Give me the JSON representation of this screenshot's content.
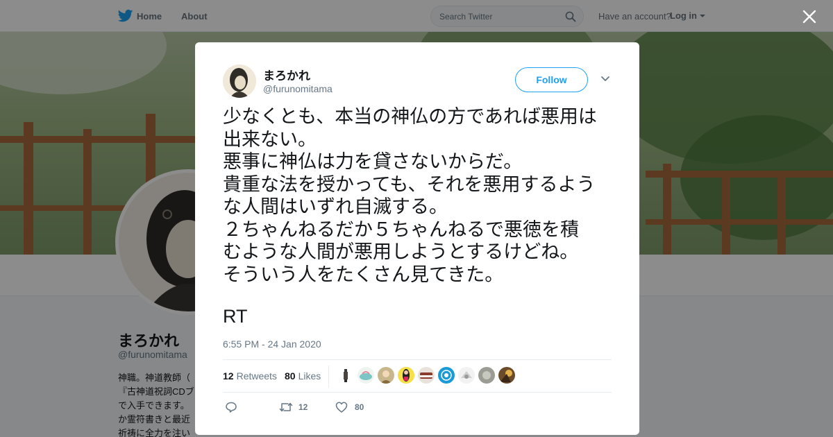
{
  "nav": {
    "home_label": "Home",
    "about_label": "About",
    "search_placeholder": "Search Twitter",
    "have_account": "Have an account?",
    "login_label": "Log in"
  },
  "profile": {
    "name": "まろかれ",
    "handle": "@furunomitama",
    "bio_lines": [
      "神職。神道教師（",
      "『古神道祝詞CDブ",
      "で入手できます。",
      "か霊符書きと最近",
      "祈祷に全力を注い"
    ]
  },
  "tweet": {
    "author_name": "まろかれ",
    "author_handle": "@furunomitama",
    "follow_label": "Follow",
    "lines": [
      "少なくとも、本当の神仏の方であれば悪用は",
      "出来ない。",
      "悪事に神仏は力を貸さないからだ。",
      "貴重な法を授かっても、それを悪用するよう",
      "な人間はいずれ自滅する。",
      "２ちゃんねるだか５ちゃんねるで悪徳を積",
      "むような人間が悪用しようとするけどね。",
      "そういう人をたくさん見てきた。"
    ],
    "rt": "RT",
    "timestamp": "6:55 PM - 24 Jan 2020",
    "retweets_count": "12",
    "retweets_label": "Retweets",
    "likes_count": "80",
    "likes_label": "Likes",
    "reply_count": "",
    "retweet_action_count": "12",
    "like_action_count": "80"
  },
  "colors": {
    "accent": "#1da1f2",
    "muted": "#657786",
    "text": "#14171a"
  },
  "icons": [
    "twitter-bird-icon",
    "search-icon",
    "close-icon",
    "chevron-down-icon",
    "reply-icon",
    "retweet-icon",
    "heart-icon"
  ]
}
